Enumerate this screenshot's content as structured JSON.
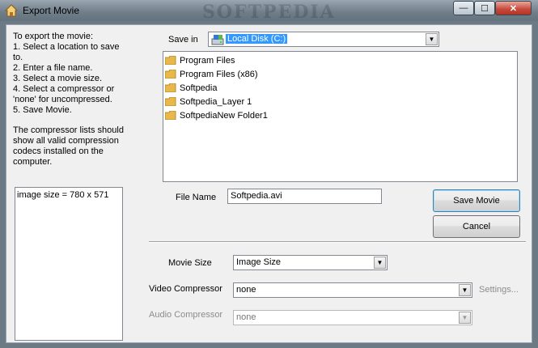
{
  "window": {
    "title": "Export Movie",
    "watermark": "SOFTPEDIA",
    "controls": {
      "minimize": "—",
      "maximize": "☐",
      "close": "✕"
    }
  },
  "instructions": {
    "lines": [
      "To export the movie:",
      " 1. Select a location to save",
      "to.",
      " 2. Enter a file name.",
      " 3. Select a movie size.",
      " 4. Select a compressor or",
      "    'none' for uncompressed.",
      " 5. Save Movie."
    ],
    "note_lines": [
      "The compressor lists should",
      "show all valid compression",
      "codecs installed on the",
      "computer."
    ]
  },
  "info_box": {
    "text": "image size = 780 x 571"
  },
  "save_in": {
    "label": "Save in",
    "value": "Local Disk (C:)",
    "icon": "drive-icon"
  },
  "folders": [
    {
      "name": "Program Files",
      "icon": "folder-icon"
    },
    {
      "name": "Program Files (x86)",
      "icon": "folder-icon"
    },
    {
      "name": "Softpedia",
      "icon": "folder-icon"
    },
    {
      "name": "Softpedia_Layer 1",
      "icon": "folder-icon"
    },
    {
      "name": "SoftpediaNew Folder1",
      "icon": "folder-icon"
    }
  ],
  "file_name": {
    "label": "File Name",
    "value": "Softpedia.avi"
  },
  "buttons": {
    "save": "Save Movie",
    "cancel": "Cancel",
    "settings": "Settings..."
  },
  "movie_size": {
    "label": "Movie Size",
    "value": "Image Size"
  },
  "video_compressor": {
    "label": "Video Compressor",
    "value": "none"
  },
  "audio_compressor": {
    "label": "Audio Compressor",
    "value": "none"
  },
  "colors": {
    "selection": "#3399ff",
    "folder": "#e8b84a"
  }
}
